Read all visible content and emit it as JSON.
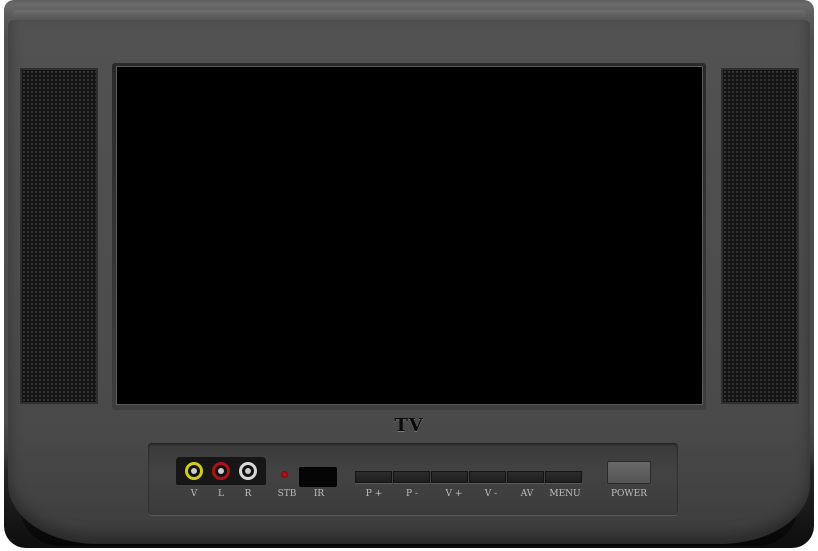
{
  "logo": "TV",
  "jacks": [
    {
      "label": "V",
      "color": "#cfcf10"
    },
    {
      "label": "L",
      "color": "#b0101a"
    },
    {
      "label": "R",
      "color": "#d8d8d8"
    }
  ],
  "indicators": {
    "standby_label": "STB",
    "ir_label": "IR"
  },
  "buttons": [
    "P +",
    "P -",
    "V +",
    "V -",
    "AV",
    "MENU"
  ],
  "power_label": "POWER"
}
